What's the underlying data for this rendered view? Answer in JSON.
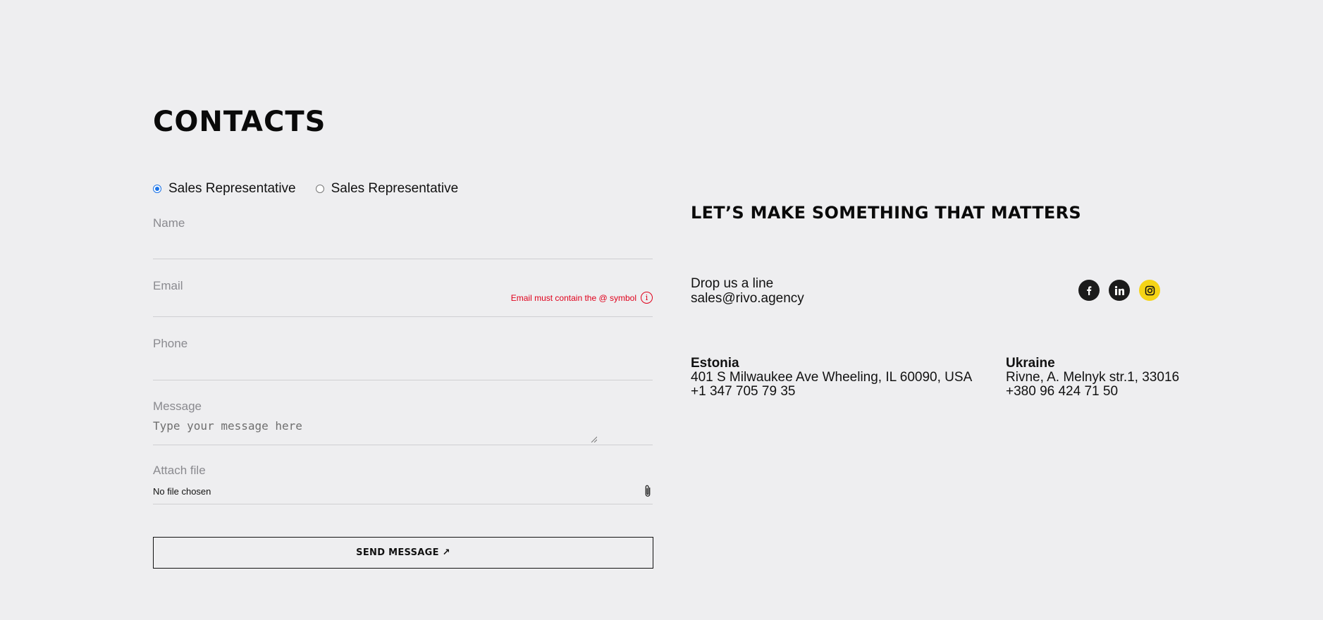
{
  "page": {
    "title": "CONTACTS"
  },
  "form": {
    "radio_options": [
      {
        "label": "Sales Representative",
        "checked": true
      },
      {
        "label": "Sales Representative",
        "checked": false
      }
    ],
    "name": {
      "label": "Name",
      "value": ""
    },
    "email": {
      "label": "Email",
      "value": "",
      "error": "Email must contain the @ symbol",
      "error_icon": "info-icon"
    },
    "phone": {
      "label": "Phone",
      "value": ""
    },
    "message": {
      "label": "Message",
      "placeholder": "Type your message here"
    },
    "attach": {
      "label": "Attach file",
      "status": "No file chosen",
      "icon": "paperclip-icon"
    },
    "submit_label": "SEND MESSAGE ↗"
  },
  "info": {
    "tagline": "LET’S MAKE SOMETHING THAT MATTERS",
    "contact": {
      "heading": "Drop us a line",
      "email": "sales@rivo.agency"
    },
    "socials": [
      {
        "name": "facebook-icon",
        "color": "#1b1b1b"
      },
      {
        "name": "linkedin-icon",
        "color": "#1b1b1b"
      },
      {
        "name": "instagram-icon",
        "color": "#f5d416"
      }
    ],
    "offices": [
      {
        "country": "Estonia",
        "address": "401 S Milwaukee Ave Wheeling, IL 60090, USA",
        "phone": "+1 347 705 79 35"
      },
      {
        "country": "Ukraine",
        "address": "Rivne, A. Melnyk str.1, 33016",
        "phone": "+380 96 424 71 50"
      }
    ]
  },
  "colors": {
    "background": "#eeeef0",
    "error": "#e0001b",
    "accent_radio": "#1a73e8",
    "instagram": "#f5d416"
  }
}
